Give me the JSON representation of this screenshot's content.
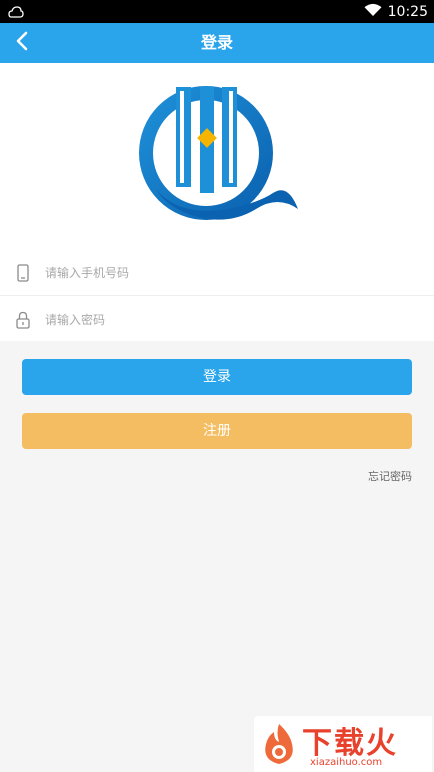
{
  "status_bar": {
    "time": "10:25",
    "wifi_icon": "wifi-icon",
    "app_icon": "notification-app-icon"
  },
  "header": {
    "title": "登录",
    "back_icon": "chevron-left-icon"
  },
  "colors": {
    "primary": "#2aa4ea",
    "register": "#f5bd62",
    "background": "#f5f5f5"
  },
  "form": {
    "phone_placeholder": "请输入手机号码",
    "phone_icon": "phone-icon",
    "password_placeholder": "请输入密码",
    "password_icon": "lock-icon"
  },
  "buttons": {
    "login": "登录",
    "register": "注册"
  },
  "forgot_password": "忘记密码",
  "watermark": {
    "text": "下载火",
    "site": "xiazaihuo.com"
  }
}
